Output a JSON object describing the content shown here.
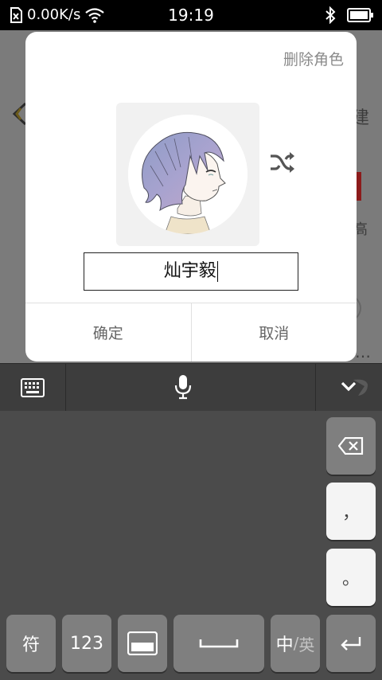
{
  "status_bar": {
    "network_speed": "0.00K/s",
    "time": "19:19"
  },
  "background_app": {
    "partial_text_right": "建",
    "partial_text_right_2": "高",
    "overflow_dots": "…"
  },
  "dialog": {
    "delete_role_label": "删除角色",
    "name_value": "灿宇毅",
    "confirm_label": "确定",
    "cancel_label": "取消"
  },
  "keyboard": {
    "keys": {
      "symbols": "符",
      "numbers": "123",
      "comma": "，",
      "period": "。",
      "lang_zh": "中",
      "lang_sep": "/",
      "lang_en": "英"
    }
  },
  "colors": {
    "dialog_bg": "#ffffff",
    "keyboard_bg": "#4b4b4b",
    "dark_key": "#7f7f7f",
    "light_key": "#f4f4f4"
  }
}
